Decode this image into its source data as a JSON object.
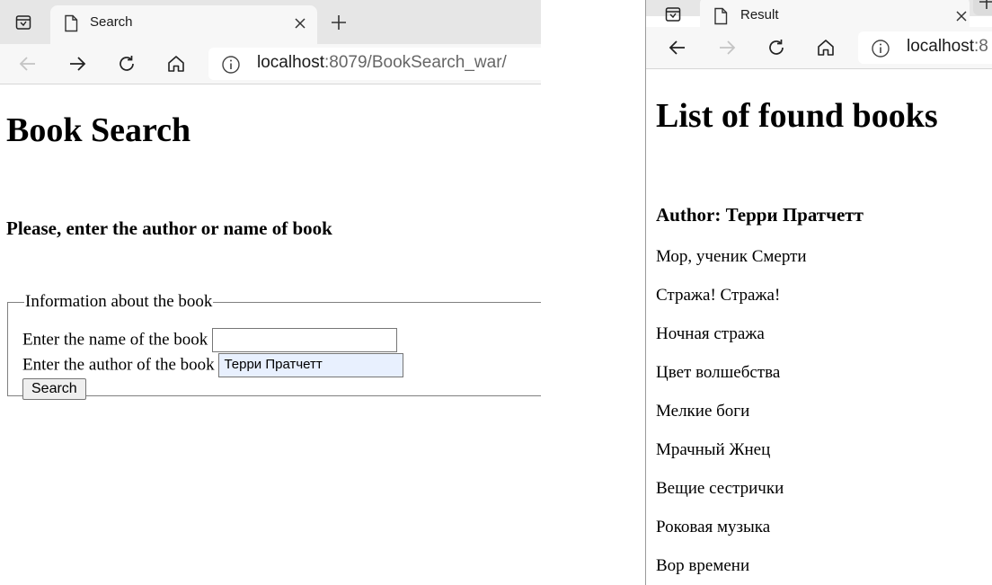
{
  "left_window": {
    "tab": {
      "title": "Search"
    },
    "address": {
      "host": "localhost",
      "rest": ":8079/BookSearch_war/"
    },
    "page": {
      "heading": "Book Search",
      "subheading": "Please, enter the author or name of book",
      "fieldset_legend": "Information about the book",
      "name_label": "Enter the name of the book",
      "name_value": "",
      "author_label": "Enter the author of the book",
      "author_value": "Терри Пратчетт",
      "search_button": "Search"
    }
  },
  "right_window": {
    "tab": {
      "title": "Result"
    },
    "address": {
      "host": "localhost",
      "rest": ":8"
    },
    "page": {
      "heading": "List of found books",
      "author_line": "Author: Терри Пратчетт",
      "books": [
        "Мор, ученик Смерти",
        "Стража! Стража!",
        "Ночная стража",
        "Цвет волшебства",
        "Мелкие боги",
        "Мрачный Жнец",
        "Вещие сестрички",
        "Роковая музыка",
        "Вор времени"
      ]
    }
  },
  "icons": [
    "tab-actions-icon",
    "page-icon",
    "close-icon",
    "plus-icon",
    "back-icon",
    "forward-icon",
    "reload-icon",
    "home-icon",
    "info-icon"
  ],
  "colors": {
    "tabstrip": "#e6e6e6",
    "toolbar": "#f7f7f7",
    "autofill": "#e8f0fe",
    "url_rest": "#666666"
  }
}
